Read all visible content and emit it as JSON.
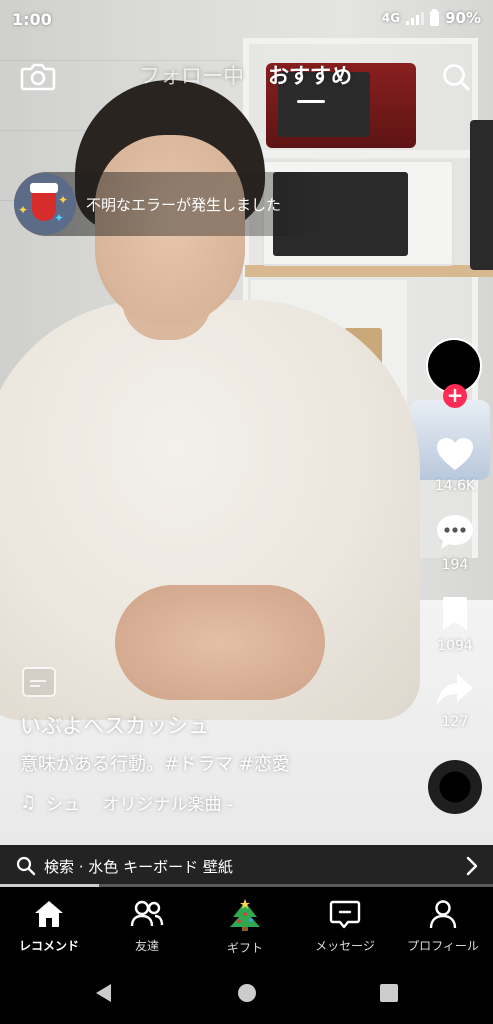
{
  "status_bar": {
    "time": "1:00",
    "network": "4G",
    "battery": "90%"
  },
  "top_nav": {
    "tab_following": "フォロー中",
    "tab_foryou": "おすすめ",
    "active_tab": "おすすめ"
  },
  "toast": {
    "message": "不明なエラーが発生しました"
  },
  "actions": {
    "likes": "14.6K",
    "comments": "194",
    "saves": "1094",
    "shares": "127"
  },
  "post": {
    "username": "いぶよへスカッシュ",
    "description": "意味がある行動。#ドラマ #恋愛",
    "music": "シュ　 オリジナル楽曲 -"
  },
  "search_suggestion": {
    "text": "検索 · 水色 キーボード 壁紙"
  },
  "video_progress": 0.2,
  "bottom_nav": {
    "home": "レコメンド",
    "friends": "友達",
    "gift": "ギフト",
    "messages": "メッセージ",
    "profile": "プロフィール"
  },
  "icons": {
    "camera": "camera-icon",
    "search": "search-icon",
    "like": "heart-icon",
    "comment": "comment-icon",
    "save": "bookmark-icon",
    "share": "share-icon",
    "home": "home-icon",
    "friends": "friends-icon",
    "gift": "christmas-tree-icon",
    "messages": "message-icon",
    "profile": "profile-icon"
  },
  "colors": {
    "follow_accent": "#fe2c55",
    "nav_background": "#000000"
  }
}
